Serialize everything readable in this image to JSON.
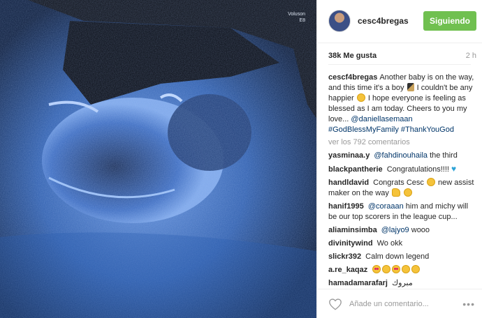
{
  "photo": {
    "label_line1": "Voluson",
    "label_line2": "E8"
  },
  "header": {
    "username": "cesc4bregas",
    "follow_label": "Siguiendo"
  },
  "stats": {
    "likes": "38k Me gusta",
    "time": "2 h"
  },
  "caption": {
    "user": "cescf4bregas",
    "text_part1": "Another baby is on the way, and this time it's a boy",
    "text_part2": "I couldn't be any happier",
    "text_part3": "I hope everyone is feeling as blessed as I am today. Cheers to you my love...",
    "tag1": "@daniellasemaan",
    "tag2": "#GodBlessMyFamily",
    "tag3": "#ThankYouGod"
  },
  "view_all": "ver los 792 comentarios",
  "comments": [
    {
      "user": "yasminaa.y",
      "tag": "@fahdinouhaila",
      "text": "the third"
    },
    {
      "user": "blackpantherie",
      "text": "Congratulations!!!!"
    },
    {
      "user": "handldavid",
      "text": "Congrats Cesc",
      "text2": "new assist maker on the way"
    },
    {
      "user": "hanif1995",
      "tag": "@coraaan",
      "text": "him and michy will be our top scorers in the league cup..."
    },
    {
      "user": "aliaminsimba",
      "tag": "@lajyo9",
      "text": "wooo"
    },
    {
      "user": "divinitywind",
      "text": "Wo okk"
    },
    {
      "user": "slickr392",
      "text": "Calm down legend"
    },
    {
      "user": "a.re_kaqaz",
      "text": ""
    },
    {
      "user": "hamadamarafarj",
      "text": "مبروك"
    }
  ],
  "add_comment": {
    "placeholder": "Añade un comentario..."
  },
  "icons": {
    "heart": "heart-icon",
    "more": "more-options-icon",
    "avatar": "avatar"
  },
  "colors": {
    "follow": "#70c050",
    "tag": "#003569",
    "muted": "#999999",
    "ultrasound": "#5b8fd6"
  }
}
